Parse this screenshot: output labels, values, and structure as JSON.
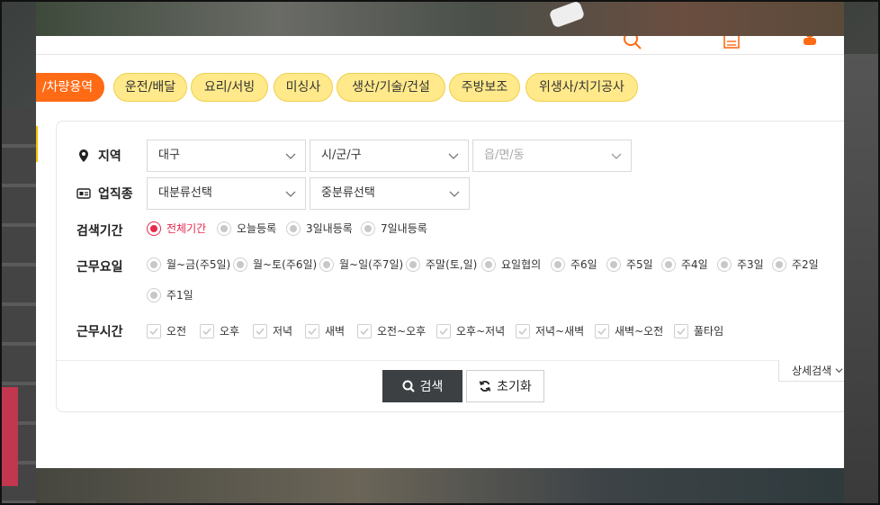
{
  "categories": [
    {
      "label": "/차량용역",
      "active": true
    },
    {
      "label": "운전/배달",
      "active": false
    },
    {
      "label": "요리/서빙",
      "active": false
    },
    {
      "label": "미싱사",
      "active": false
    },
    {
      "label": "생산/기술/건설",
      "active": false
    },
    {
      "label": "주방보조",
      "active": false
    },
    {
      "label": "위생사/치기공사",
      "active": false
    }
  ],
  "filters": {
    "region": {
      "label": "지역",
      "selects": [
        {
          "value": "대구",
          "disabled": false
        },
        {
          "value": "시/군/구",
          "disabled": false
        },
        {
          "value": "읍/면/동",
          "disabled": true
        }
      ]
    },
    "job_type": {
      "label": "업직종",
      "selects": [
        {
          "value": "대분류선택"
        },
        {
          "value": "중분류선택"
        }
      ]
    },
    "period": {
      "label": "검색기간",
      "options": [
        "전체기간",
        "오늘등록",
        "3일내등록",
        "7일내등록"
      ],
      "selected": "전체기간"
    },
    "workdays": {
      "label": "근무요일",
      "options": [
        "월~금(주5일)",
        "월~토(주6일)",
        "월~일(주7일)",
        "주말(토,일)",
        "요일협의",
        "주6일",
        "주5일",
        "주4일",
        "주3일",
        "주2일",
        "주1일"
      ]
    },
    "worktime": {
      "label": "근무시간",
      "options": [
        "오전",
        "오후",
        "저녁",
        "새벽",
        "오전~오후",
        "오후~저녁",
        "저녁~새벽",
        "새벽~오전",
        "풀타임"
      ]
    }
  },
  "actions": {
    "search_label": "검색",
    "reset_label": "초기화",
    "detail_label": "상세검색"
  },
  "colors": {
    "accent": "#ff6a14",
    "chip": "#ffe98a",
    "selected_radio": "#e8294d",
    "button_dark": "#3c4043"
  }
}
